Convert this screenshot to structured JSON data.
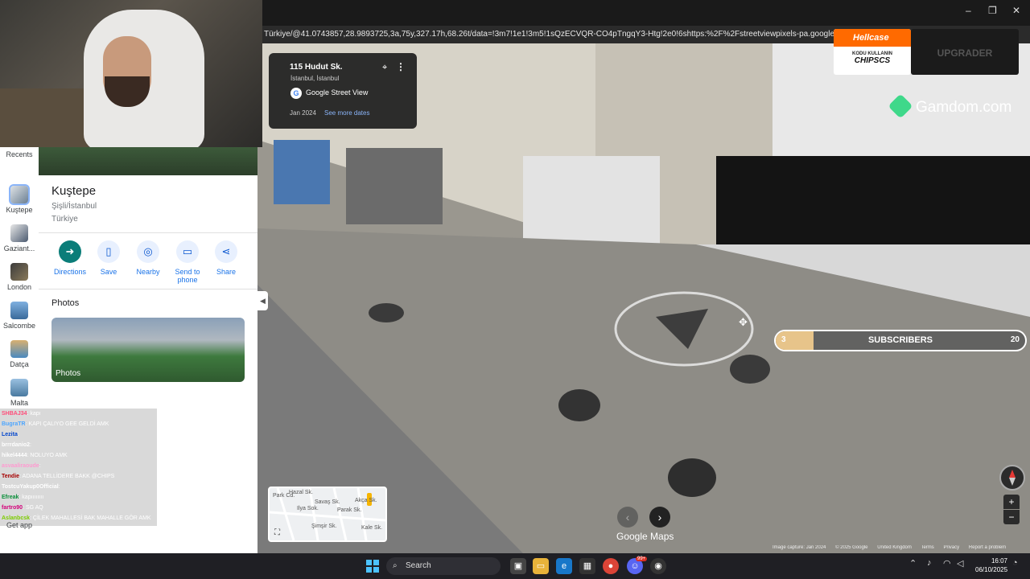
{
  "browser": {
    "url": "Türkiye/@41.0743857,28.9893725,3a,75y,327.17h,68.26t/data=!3m7!1e1!3m5!1sQzECVQR-CO4pTngqY3-Htg!2e0!6shttps:%2F%2Fstreetviewpixels-pa.googleapis.com%2Fv1%",
    "min": "–",
    "max": "❐",
    "close": "✕"
  },
  "sidebar": {
    "recents": "Recents",
    "items": [
      {
        "label": "Kuştepe"
      },
      {
        "label": "Gaziant..."
      },
      {
        "label": "London"
      },
      {
        "label": "Salcombe"
      },
      {
        "label": "Datça"
      },
      {
        "label": "Malta"
      }
    ],
    "get_app": "Get app"
  },
  "place": {
    "name": "Kuştepe",
    "district": "Şişli/İstanbul",
    "country": "Türkiye",
    "actions": [
      {
        "label": "Directions",
        "icon": "directions-icon"
      },
      {
        "label": "Save",
        "icon": "bookmark-icon"
      },
      {
        "label": "Nearby",
        "icon": "nearby-icon"
      },
      {
        "label": "Send to phone",
        "icon": "phone-icon"
      },
      {
        "label": "Share",
        "icon": "share-icon"
      }
    ],
    "photos_title": "Photos",
    "photo_label": "Photos"
  },
  "streetview": {
    "address": "115 Hudut Sk.",
    "city": "İstanbul, İstanbul",
    "brand": "Google Street View",
    "date": "Jan 2024",
    "see_more": "See more dates",
    "google_maps": "Google Maps",
    "footer": [
      "Image capture: Jan 2024",
      "© 2025 Google",
      "United Kingdom",
      "Terms",
      "Privacy",
      "Report a problem"
    ],
    "minimap_streets": [
      "Park Cd.",
      "Hazal Sk.",
      "Ilya Sok.",
      "Savaş Sk.",
      "Parak Sk.",
      "Akça Sk.",
      "Şimşir Sk.",
      "Kale Sk."
    ]
  },
  "overlays": {
    "hellcase": "Hellcase",
    "hellcase_sub": "KODU KULLANIN",
    "hellcase_code": "CHIPSCS",
    "upgrader": "UPGRADER",
    "gamdom": "Gamdom.com",
    "subscribers": {
      "label": "SUBSCRIBERS",
      "current": "3",
      "goal": "20",
      "progress": 0.15
    }
  },
  "chat": [
    {
      "user": "SHBAJ34",
      "msg": ": kapı",
      "color": "#ff4d7a"
    },
    {
      "user": "BugraTR",
      "msg": ": KAPI ÇALIYO GEE GELDİ AMK",
      "color": "#4da6ff"
    },
    {
      "user": "Lezita",
      "msg": ": ",
      "color": "#0044cc"
    },
    {
      "user": "brrrdanio2",
      "msg": ": ",
      "color": "#ffffff"
    },
    {
      "user": "hikel4444",
      "msg": ": NOLUYO AMK",
      "color": "#ffffff"
    },
    {
      "user": "asvaaliraoude",
      "msg": ": ",
      "color": "#ff9ad0"
    },
    {
      "user": "Tendie",
      "msg": ": ADANA TELLİDERE BAKK @CHIPS",
      "color": "#a60000"
    },
    {
      "user": "TostcuYakup0Official",
      "msg": ": ",
      "color": "#ffffff"
    },
    {
      "user": "Efreak",
      "msg": ": kapıııııııı",
      "color": "#0a8f3a"
    },
    {
      "user": "fartro90",
      "msg": ": SG AQ",
      "color": "#d4007a"
    },
    {
      "user": "Aslanbcsk",
      "msg": ": ÇİLEK MAHALLESİ BAK MAHALLE GÖR AMK",
      "color": "#7ccc00"
    }
  ],
  "taskbar": {
    "search": "Search",
    "time": "16:07",
    "date": "06/10/2025",
    "badge": "99+"
  }
}
